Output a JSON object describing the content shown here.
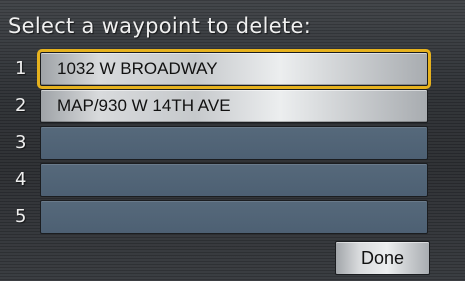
{
  "title": "Select a waypoint to delete:",
  "waypoints": [
    {
      "number": "1",
      "label": "1032 W BROADWAY"
    },
    {
      "number": "2",
      "label": "MAP/930 W 14TH AVE"
    },
    {
      "number": "3",
      "label": ""
    },
    {
      "number": "4",
      "label": ""
    },
    {
      "number": "5",
      "label": ""
    }
  ],
  "done_label": "Done",
  "colors": {
    "highlight": "#e6b21e",
    "empty_slot": "#516476",
    "background": "#2e3135"
  }
}
